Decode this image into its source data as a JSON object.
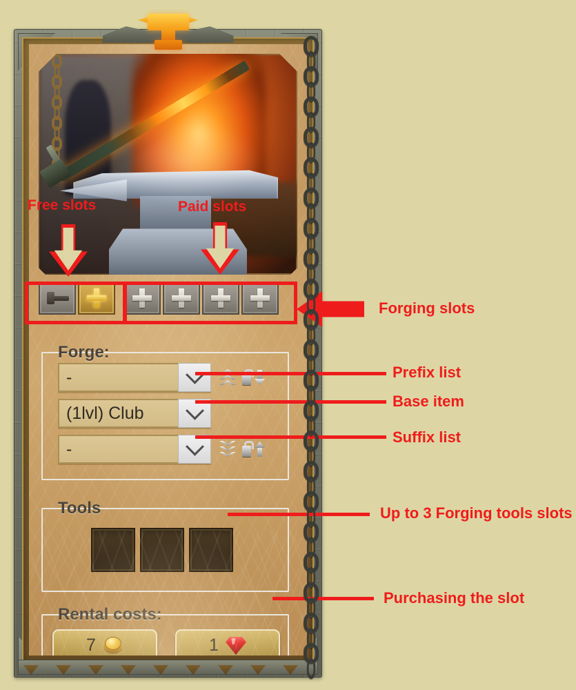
{
  "window": {
    "title": "Forge",
    "crest_icon": "anvil-icon"
  },
  "artwork": {
    "description": "blacksmith-anvil-with-glowing-sword"
  },
  "slots": {
    "free": [
      {
        "icon": "hammer-icon",
        "state": "occupied",
        "label": ""
      },
      {
        "icon": "plus-icon",
        "state": "active",
        "label": ""
      }
    ],
    "paid": [
      {
        "icon": "plus-icon",
        "state": "locked",
        "label": ""
      },
      {
        "icon": "plus-icon",
        "state": "locked",
        "label": ""
      },
      {
        "icon": "plus-icon",
        "state": "locked",
        "label": ""
      },
      {
        "icon": "plus-icon",
        "state": "locked",
        "label": ""
      }
    ]
  },
  "forge": {
    "title": "Forge:",
    "prefix": {
      "value": "-",
      "icons": [
        "chevrons-up-icon",
        "lock-arrow-down-icon"
      ]
    },
    "base": {
      "value": "(1lvl) Club",
      "icons": []
    },
    "suffix": {
      "value": "-",
      "icons": [
        "chevrons-down-icon",
        "lock-arrow-up-icon"
      ]
    }
  },
  "tools": {
    "title": "Tools",
    "slots": [
      "",
      "",
      ""
    ]
  },
  "rental": {
    "title": "Rental costs:",
    "buttons": [
      {
        "amount": "7",
        "currency_icon": "gold-coin-icon"
      },
      {
        "amount": "1",
        "currency_icon": "red-gem-icon"
      }
    ]
  },
  "annotations": {
    "free_slots": "Free slots",
    "paid_slots": "Paid slots",
    "forging_slots": "Forging slots",
    "prefix_list": "Prefix list",
    "base_item": "Base item",
    "suffix_list": "Suffix list",
    "tools_slots": "Up to 3 Forging tools slots",
    "purchasing": "Purchasing the slot",
    "color": "#ef1c1c"
  }
}
